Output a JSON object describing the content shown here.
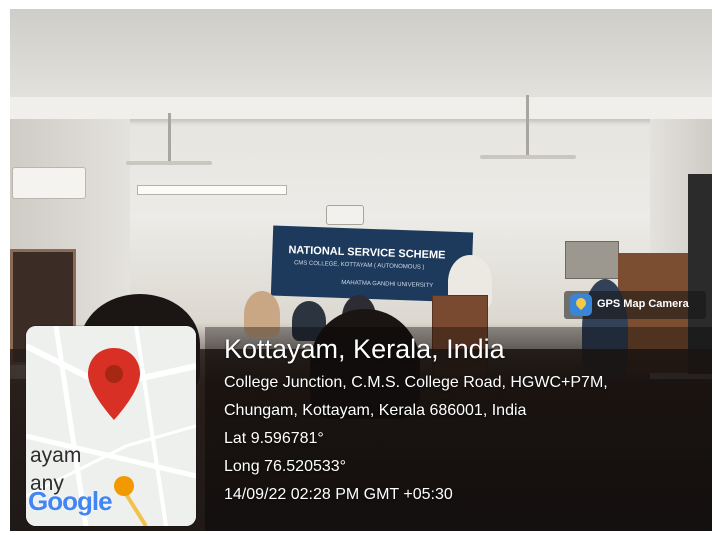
{
  "overlay": {
    "app_badge": "GPS Map Camera",
    "location_title": "Kottayam, Kerala, India",
    "address_line1": "College Junction, C.M.S. College Road, HGWC+P7M,",
    "address_line2": "Chungam, Kottayam, Kerala 686001, India",
    "latitude": "Lat 9.596781°",
    "longitude": "Long 76.520533°",
    "datetime": "14/09/22 02:28 PM GMT +05:30"
  },
  "map": {
    "label1": "ayam",
    "label2": "any",
    "logo": "Google",
    "pin_icon": "map-pin-icon",
    "pin_color": "#d93025"
  },
  "scene": {
    "banner_line1": "NATIONAL SERVICE SCHEME",
    "banner_line2": "CMS COLLEGE, KOTTAYAM ( AUTONOMOUS )",
    "banner_line3": "MAHATMA GANDHI UNIVERSITY"
  }
}
